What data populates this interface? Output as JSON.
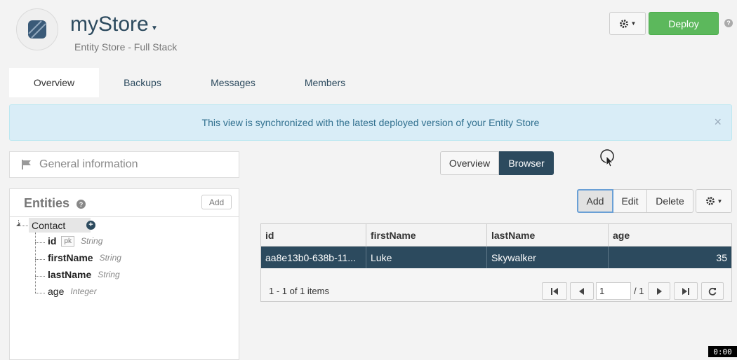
{
  "header": {
    "title": "myStore",
    "subtitle": "Entity Store - Full Stack",
    "deploy_label": "Deploy",
    "help_glyph": "?",
    "logo_icon": "store-logo-icon",
    "accent_color": "#2c4a5e",
    "deploy_color": "#5cb85c"
  },
  "tabs": [
    {
      "label": "Overview",
      "active": true
    },
    {
      "label": "Backups",
      "active": false
    },
    {
      "label": "Messages",
      "active": false
    },
    {
      "label": "Members",
      "active": false
    }
  ],
  "banner": {
    "text": "This view is synchronized with the latest deployed version of your Entity Store",
    "close_glyph": "×"
  },
  "sidebar": {
    "general_info_label": "General information",
    "entities_title": "Entities",
    "entities_help": "?",
    "add_label": "Add",
    "entity": {
      "name": "Contact",
      "add_glyph": "+",
      "fields": [
        {
          "name": "id",
          "pk": "pk",
          "type": "String"
        },
        {
          "name": "firstName",
          "type": "String"
        },
        {
          "name": "lastName",
          "type": "String"
        },
        {
          "name": "age",
          "type": "Integer"
        }
      ]
    }
  },
  "view_switch": {
    "overview_label": "Overview",
    "browser_label": "Browser",
    "active": "Browser"
  },
  "toolbar": {
    "add_label": "Add",
    "edit_label": "Edit",
    "delete_label": "Delete"
  },
  "grid": {
    "columns": [
      "id",
      "firstName",
      "lastName",
      "age"
    ],
    "rows": [
      [
        "aa8e13b0-638b-11...",
        "Luke",
        "Skywalker",
        "35"
      ]
    ],
    "selected_row": 0,
    "pager": {
      "info": "1 - 1 of 1 items",
      "page": "1",
      "of_text": "/ 1"
    }
  },
  "recording_timer": "0:00"
}
